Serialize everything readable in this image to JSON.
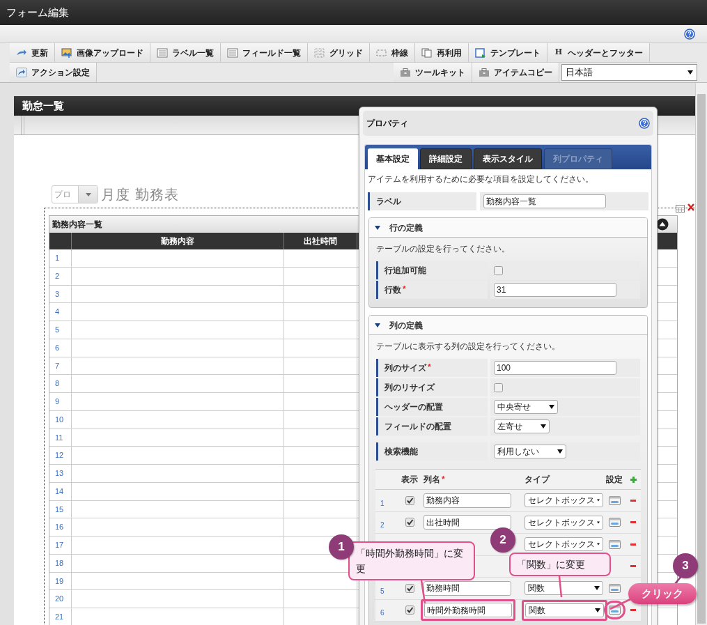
{
  "window": {
    "title": "フォーム編集"
  },
  "toolbar": {
    "row1": [
      {
        "label": "更新",
        "kind": "update"
      },
      {
        "label": "画像アップロード",
        "kind": "image"
      },
      {
        "label": "ラベル一覧",
        "kind": "list"
      },
      {
        "label": "フィールド一覧",
        "kind": "list"
      },
      {
        "label": "グリッド",
        "kind": "grid"
      },
      {
        "label": "枠線",
        "kind": "border"
      },
      {
        "label": "再利用",
        "kind": "copy"
      },
      {
        "label": "テンプレート",
        "kind": "template"
      },
      {
        "label": "ヘッダーとフッター",
        "kind": "glyph",
        "glyph": "H"
      }
    ],
    "row2_left": [
      {
        "label": "アクション設定",
        "kind": "action"
      }
    ],
    "row2_right": [
      {
        "label": "ツールキット",
        "kind": "case"
      },
      {
        "label": "アイテムコピー",
        "kind": "case"
      }
    ],
    "language": "日本語"
  },
  "form": {
    "title": "勤怠一覧",
    "date_select": "プロ",
    "heading": "月度 勤務表",
    "table": {
      "title": "勤務内容一覧",
      "columns": [
        "勤務内容",
        "出社時間"
      ],
      "rows": [
        "1",
        "2",
        "3",
        "4",
        "5",
        "6",
        "7",
        "8",
        "9",
        "10",
        "11",
        "12",
        "13",
        "14",
        "15",
        "16",
        "17",
        "18",
        "19",
        "20",
        "21"
      ]
    }
  },
  "properties": {
    "title": "プロパティ",
    "tabs": [
      {
        "label": "基本設定",
        "selected": true,
        "disabled": false
      },
      {
        "label": "詳細設定",
        "selected": false,
        "disabled": false
      },
      {
        "label": "表示スタイル",
        "selected": false,
        "disabled": false
      },
      {
        "label": "列プロパティ",
        "selected": false,
        "disabled": true
      }
    ],
    "description": "アイテムを利用するために必要な項目を設定してください。",
    "label_field": {
      "label": "ラベル",
      "value": "勤務内容一覧"
    },
    "sections": [
      {
        "title": "行の定義",
        "expanded": true,
        "description": "テーブルの設定を行ってください。",
        "fields": [
          {
            "label": "行追加可能",
            "kind": "checkbox",
            "checked": false
          },
          {
            "label": "行数",
            "mark": "*",
            "kind": "text",
            "value": "31"
          }
        ]
      },
      {
        "title": "列の定義",
        "expanded": true,
        "description": "テーブルに表示する列の設定を行ってください。",
        "fields": [
          {
            "label": "列のサイズ",
            "mark": "*",
            "kind": "text",
            "value": "100"
          },
          {
            "label": "列のリサイズ",
            "kind": "checkbox",
            "checked": false
          },
          {
            "label": "ヘッダーの配置",
            "kind": "select",
            "value": "中央寄せ"
          },
          {
            "label": "フィールドの配置",
            "kind": "select",
            "value": "左寄せ"
          },
          {
            "label": "検索機能",
            "kind": "select",
            "value": "利用しない"
          }
        ]
      }
    ],
    "columns_table": {
      "headers": [
        {
          "label": "表示"
        },
        {
          "label": "列名",
          "mark": "*"
        },
        {
          "label": "タイプ"
        },
        {
          "label": "設定"
        }
      ],
      "rows": [
        {
          "number": "1",
          "checked": true,
          "name": "勤務内容",
          "type": "セレクトボックス",
          "highlight": false
        },
        {
          "number": "2",
          "checked": true,
          "name": "出社時間",
          "type": "セレクトボックス",
          "highlight": false
        },
        {
          "type": "セレクトボックス",
          "highlight": false
        },
        {},
        {
          "number": "5",
          "checked": true,
          "name": "勤務時間",
          "type": "関数",
          "highlight": false
        },
        {
          "number": "6",
          "checked": true,
          "name": "時間外勤務時間",
          "type": "関数",
          "highlight": true
        }
      ]
    }
  },
  "annotations": [
    {
      "kind": "bubble",
      "number": "1",
      "text": "「時間外勤務時間」に変更"
    },
    {
      "kind": "bubble",
      "number": "2",
      "text": "「関数」に変更"
    },
    {
      "kind": "pill",
      "number": "3",
      "text": "クリック"
    }
  ]
}
